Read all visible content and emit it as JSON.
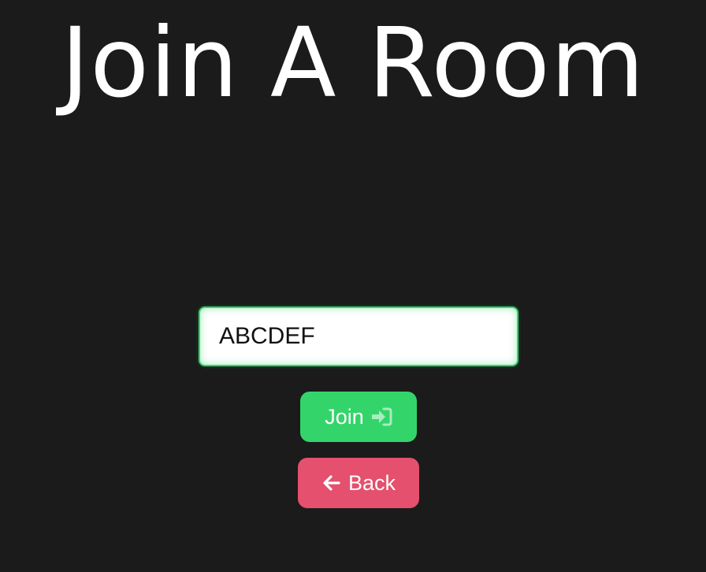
{
  "page": {
    "title": "Join A Room"
  },
  "room_code_input": {
    "value": "ABCDEF"
  },
  "join_button": {
    "label": "Join",
    "icon": "sign-in-icon"
  },
  "back_button": {
    "label": "Back",
    "icon": "arrow-left-icon"
  },
  "colors": {
    "background": "#1b1b1b",
    "accent_green": "#33d56a",
    "accent_red": "#e4506d",
    "text": "#ffffff"
  }
}
